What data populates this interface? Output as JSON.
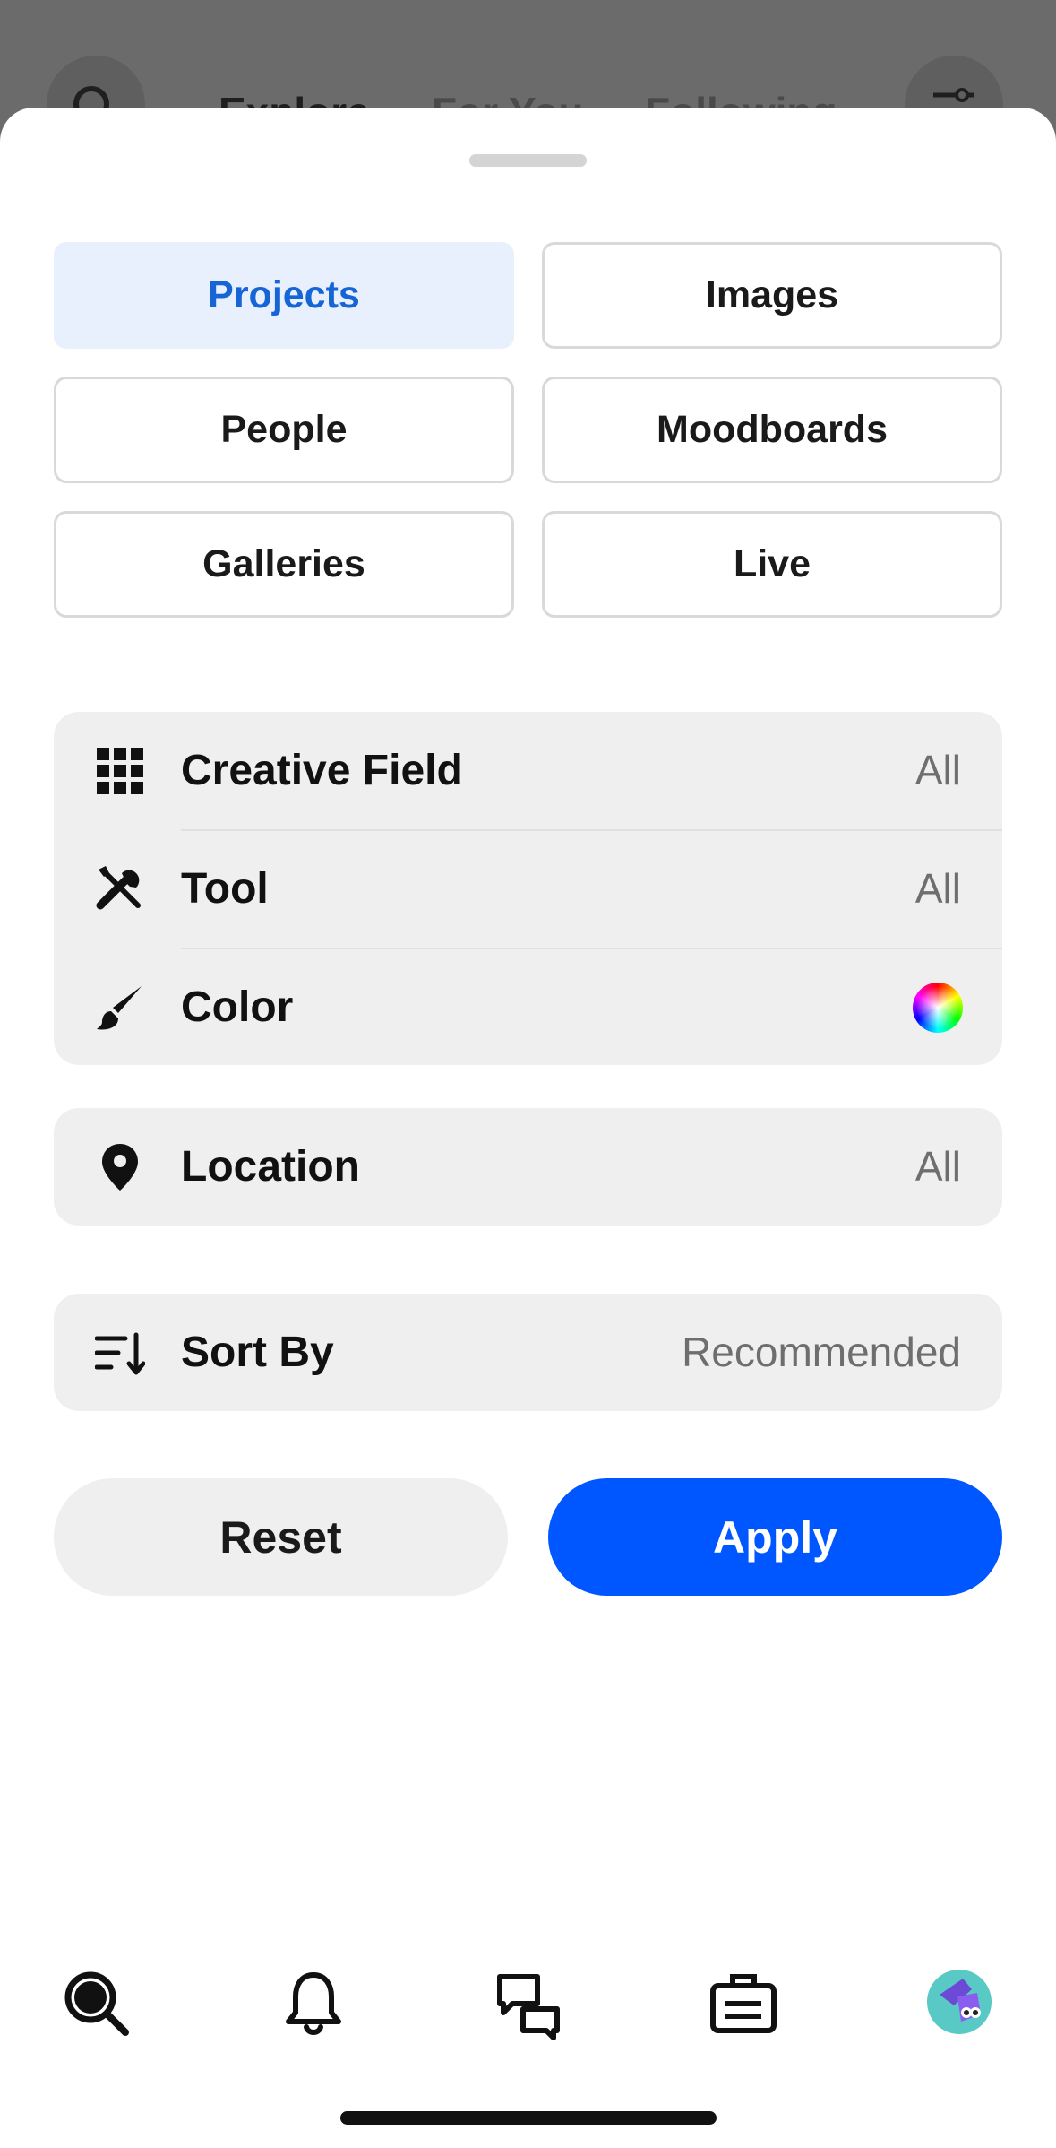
{
  "background": {
    "tabs": [
      "Explore",
      "For You",
      "Following"
    ]
  },
  "types": {
    "items": [
      {
        "label": "Projects",
        "active": true
      },
      {
        "label": "Images",
        "active": false
      },
      {
        "label": "People",
        "active": false
      },
      {
        "label": "Moodboards",
        "active": false
      },
      {
        "label": "Galleries",
        "active": false
      },
      {
        "label": "Live",
        "active": false
      }
    ]
  },
  "filters": {
    "creative_field": {
      "label": "Creative Field",
      "value": "All",
      "icon": "grid-icon"
    },
    "tool": {
      "label": "Tool",
      "value": "All",
      "icon": "tools-icon"
    },
    "color": {
      "label": "Color",
      "icon": "paintbrush-icon"
    },
    "location": {
      "label": "Location",
      "value": "All",
      "icon": "location-pin-icon"
    },
    "sort_by": {
      "label": "Sort By",
      "value": "Recommended",
      "icon": "sort-icon"
    }
  },
  "actions": {
    "reset_label": "Reset",
    "apply_label": "Apply"
  },
  "colors": {
    "accent": "#0057ff",
    "active_tab_bg": "#e8f0fd",
    "active_tab_text": "#1764d6",
    "panel_bg": "#efefef"
  },
  "tab_bar": {
    "items": [
      "search-icon",
      "bell-icon",
      "messages-icon",
      "briefcase-icon",
      "avatar"
    ]
  }
}
